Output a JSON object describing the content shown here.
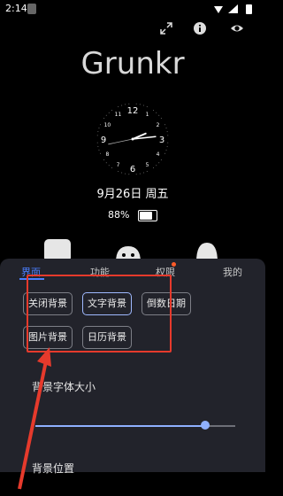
{
  "status": {
    "time": "2:14"
  },
  "home": {
    "title": "Grunkr",
    "clock_numbers": [
      "12",
      "1",
      "2",
      "3",
      "4",
      "5",
      "6",
      "7",
      "8",
      "9",
      "10",
      "11"
    ],
    "date": "9月26日 周五",
    "battery_percent": "88%",
    "battery_level": 0.88
  },
  "sheet": {
    "tabs": [
      "界面",
      "功能",
      "权限",
      "我的"
    ],
    "active_tab": 0,
    "options": [
      "关闭背景",
      "文字背景",
      "倒数日期",
      "图片背景",
      "日历背景"
    ],
    "selected_option": 1,
    "font_size_label": "背景字体大小",
    "font_size_value": 0.85,
    "position_label": "背景位置"
  },
  "colors": {
    "accent": "#4b7fff",
    "highlight_red": "#e63a2c"
  }
}
